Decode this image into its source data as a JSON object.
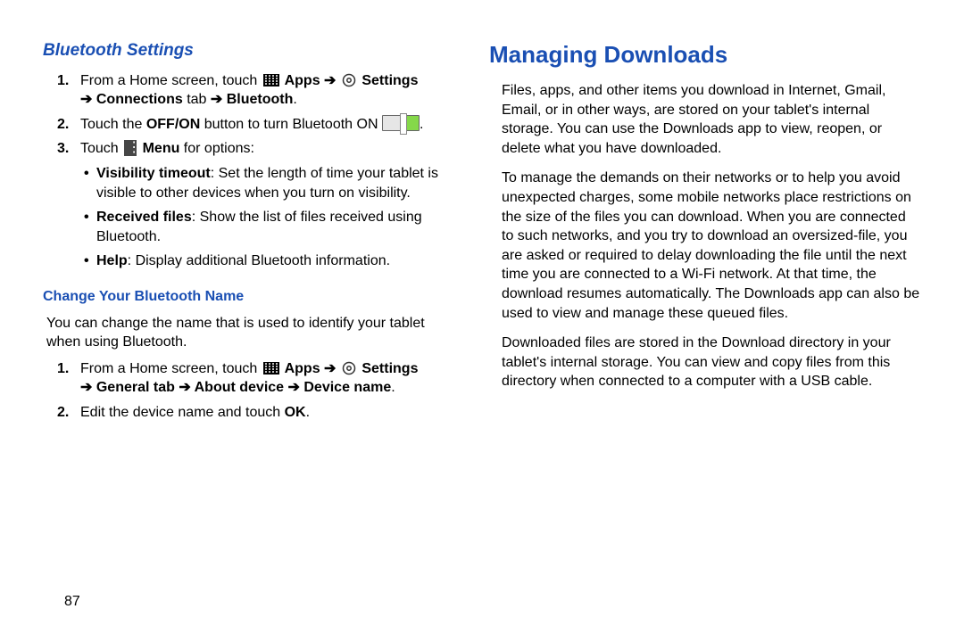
{
  "page_number": "87",
  "left": {
    "heading": "Bluetooth Settings",
    "steps": [
      {
        "n": "1.",
        "pre": "From a Home screen, touch ",
        "apps": " Apps ",
        "arrow1": "➔ ",
        "settings": " Settings ",
        "arrow2": "➔ ",
        "rest": "Connections",
        "tab_word": " tab ",
        "arrow3": "➔ ",
        "bluetooth": "Bluetooth",
        "end": "."
      },
      {
        "n": "2.",
        "pre": "Touch the ",
        "offon": "OFF/ON",
        "mid": " button to turn Bluetooth ON ",
        "end": "."
      },
      {
        "n": "3.",
        "pre": "Touch ",
        "menu": " Menu",
        "end": " for options:"
      }
    ],
    "bullets": [
      {
        "title": "Visibility timeout",
        "body": ": Set the length of time your tablet is visible to other devices when you turn on visibility."
      },
      {
        "title": "Received files",
        "body": ": Show the list of files received using Bluetooth."
      },
      {
        "title": "Help",
        "body": ": Display additional Bluetooth information."
      }
    ],
    "sub_heading": "Change Your Bluetooth Name",
    "sub_intro": "You can change the name that is used to identify your tablet when using Bluetooth.",
    "sub_steps": [
      {
        "n": "1.",
        "pre": "From a Home screen, touch ",
        "apps": " Apps ",
        "arrow1": "➔ ",
        "settings": " Settings ",
        "arrow2": "➔ ",
        "general": "General tab ",
        "arrow3": "➔ ",
        "about": "About device ",
        "arrow4": "➔ ",
        "devname": "Device name",
        "end": "."
      },
      {
        "n": "2.",
        "pre": "Edit the device name and touch ",
        "ok": "OK",
        "end": "."
      }
    ]
  },
  "right": {
    "heading": "Managing Downloads",
    "p1": "Files, apps, and other items you download in Internet, Gmail, Email, or in other ways, are stored on your tablet's internal storage. You can use the Downloads app to view, reopen, or delete what you have downloaded.",
    "p2": "To manage the demands on their networks or to help you avoid unexpected charges, some mobile networks place restrictions on the size of the files you can download. When you are connected to such networks, and you try to download an oversized-file, you are asked or required to delay downloading the file until the next time you are connected to a Wi-Fi network. At that time, the download resumes automatically. The Downloads app can also be used to view and manage these queued files.",
    "p3": "Downloaded files are stored in the Download directory in your tablet's internal storage. You can view and copy files from this directory when connected to a computer with a USB cable."
  }
}
